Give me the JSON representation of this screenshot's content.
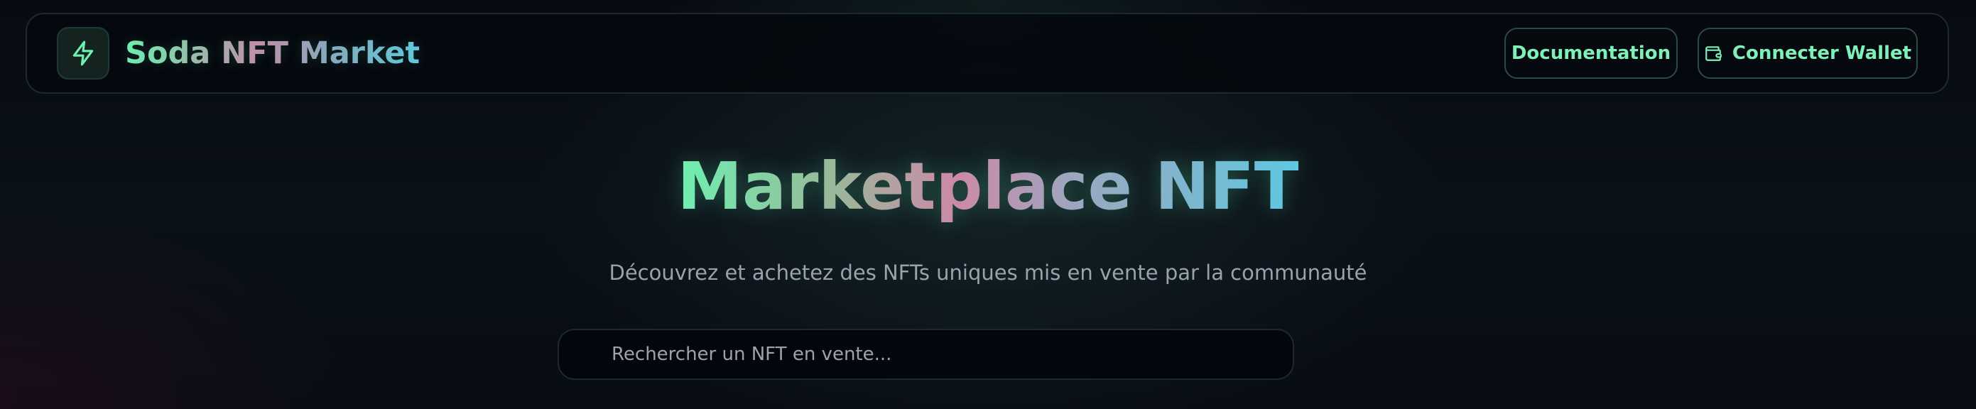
{
  "header": {
    "brand_name": "Soda NFT Market",
    "logo_icon": "lightning-bolt-icon",
    "docs_label": "Documentation",
    "wallet_label": "Connecter Wallet",
    "wallet_icon": "wallet-icon"
  },
  "hero": {
    "title": "Marketplace NFT",
    "subtitle": "Découvrez et achetez des NFTs uniques mis en vente par la communauté"
  },
  "search": {
    "placeholder": "Rechercher un NFT en vente...",
    "value": ""
  },
  "colors": {
    "accent_green": "#7ff0b8",
    "gradient_pink": "#cc8aa8",
    "gradient_cyan": "#5ec8e0",
    "background": "#080c12"
  }
}
